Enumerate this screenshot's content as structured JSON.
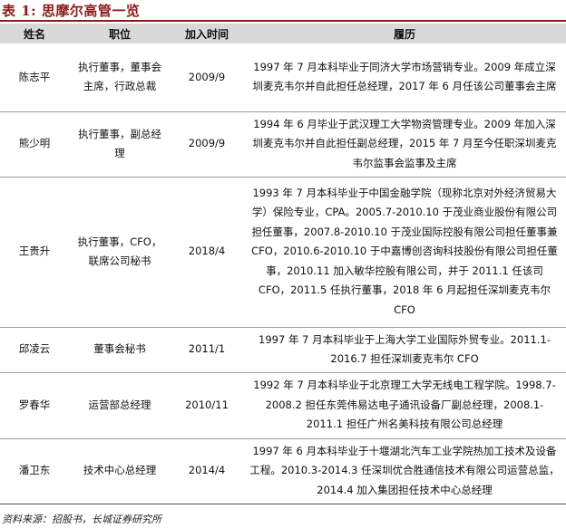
{
  "title": "表 1: 思摩尔高管一览",
  "columns": [
    "姓名",
    "职位",
    "加入时间",
    "履历"
  ],
  "rows": [
    {
      "name": "陈志平",
      "position": "执行董事，董事会主席，行政总裁",
      "joined": "2009/9",
      "resume": "1997 年 7 月本科毕业于同济大学市场营销专业。2009 年成立深圳麦克韦尔并自此担任总经理，2017 年 6 月任该公司董事会主席"
    },
    {
      "name": "熊少明",
      "position": "执行董事，副总经理",
      "joined": "2009/9",
      "resume": "1994 年 6 月毕业于武汉理工大学物资管理专业。2009 年加入深圳麦克韦尔并自此担任副总经理，2015 年 7 月至今任职深圳麦克韦尔监事会监事及主席"
    },
    {
      "name": "王贵升",
      "position": "执行董事，CFO，联席公司秘书",
      "joined": "2018/4",
      "resume": "1993 年 7 月本科毕业于中国金融学院（现称北京对外经济贸易大学）保险专业，CPA。2005.7-2010.10 于茂业商业股份有限公司担任董事，2007.8-2010.10 于茂业国际控股有限公司担任董事兼 CFO，2010.6-2010.10 于中嘉博创咨询科技股份有限公司担任董事，2010.11 加入敏华控股有限公司，并于 2011.1 任该司 CFO，2011.5 任执行董事，2018 年 6 月起担任深圳麦克韦尔 CFO"
    },
    {
      "name": "邱凌云",
      "position": "董事会秘书",
      "joined": "2011/1",
      "resume": "1997 年 7 月本科毕业于上海大学工业国际外贸专业。2011.1-2016.7 担任深圳麦克韦尔 CFO"
    },
    {
      "name": "罗春华",
      "position": "运营部总经理",
      "joined": "2010/11",
      "resume": "1992 年 7 月本科毕业于北京理工大学无线电工程学院。1998.7-2008.2 担任东莞伟易达电子通讯设备厂副总经理，2008.1-2011.1 担任广州名美科技有限公司总经理"
    },
    {
      "name": "潘卫东",
      "position": "技术中心总经理",
      "joined": "2014/4",
      "resume": "1997 年 6 月本科毕业于十堰湖北汽车工业学院热加工技术及设备工程。2010.3-2014.3 任深圳优合胜通信技术有限公司运营总监，2014.4 加入集团担任技术中心总经理"
    }
  ],
  "source": "资料来源：招股书，长城证券研究所",
  "colors": {
    "title": "#8b1a1a",
    "header_bg": "#d9d9d9"
  }
}
